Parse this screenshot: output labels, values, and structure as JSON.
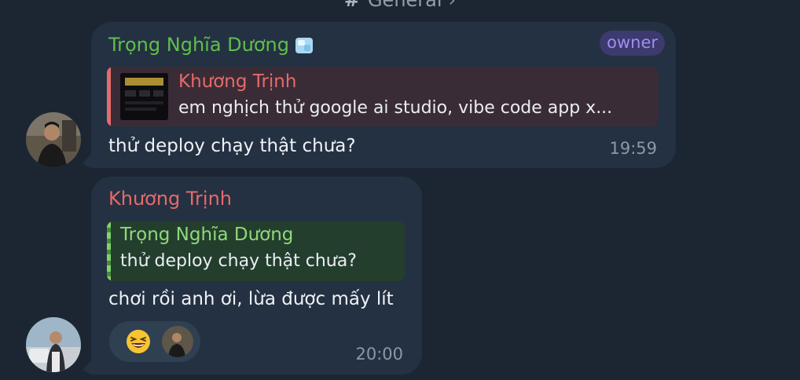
{
  "header": {
    "topic": "General"
  },
  "messages": [
    {
      "sender": "Trọng Nghĩa Dương",
      "badge": "owner",
      "reply_to": {
        "name": "Khương Trịnh",
        "text": "em nghịch thử google ai studio, vibe code app x..."
      },
      "text": "thử deploy chạy thật chưa?",
      "time": "19:59"
    },
    {
      "sender": "Khương Trịnh",
      "reply_to": {
        "name": "Trọng Nghĩa Dương",
        "text": "thử deploy chạy thật chưa?"
      },
      "text": "chơi rồi anh ơi, lừa được mấy lít",
      "time": "20:00",
      "reactions": [
        {
          "emoji": "grinning-squinting-face-icon",
          "count_avatars": 1
        }
      ]
    }
  ],
  "colors": {
    "background": "#1c2633",
    "bubble": "#243142",
    "sender_green": "#5fbf4c",
    "sender_red": "#e46b6b",
    "owner_badge_text": "#9f8ef0"
  }
}
